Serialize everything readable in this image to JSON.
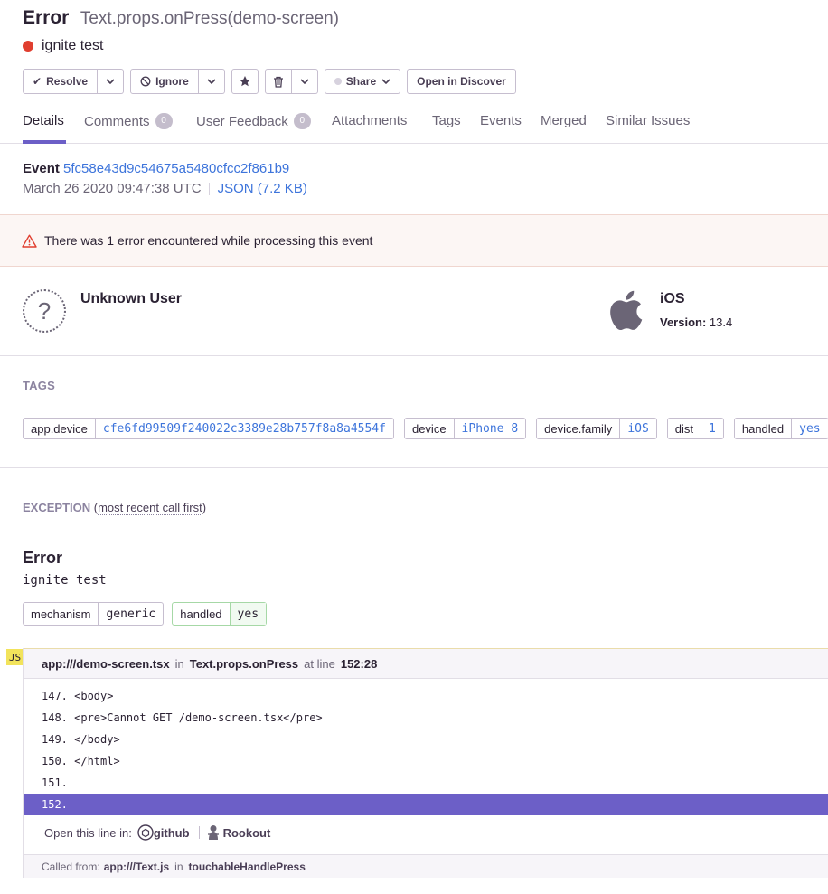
{
  "header": {
    "type": "Error",
    "culprit": "Text.props.onPress(demo-screen)",
    "message": "ignite test"
  },
  "actions": {
    "resolve": "Resolve",
    "ignore": "Ignore",
    "share": "Share",
    "open_discover": "Open in Discover"
  },
  "tabs": [
    {
      "label": "Details"
    },
    {
      "label": "Comments",
      "badge": "0"
    },
    {
      "label": "User Feedback",
      "badge": "0"
    },
    {
      "label": "Attachments"
    },
    {
      "label": "Tags"
    },
    {
      "label": "Events"
    },
    {
      "label": "Merged"
    },
    {
      "label": "Similar Issues"
    }
  ],
  "event": {
    "label": "Event",
    "id": "5fc58e43d9c54675a5480cfcc2f861b9",
    "date": "March 26 2020 09:47:38 UTC",
    "json": "JSON (7.2 KB)"
  },
  "banner": {
    "text": "There was 1 error encountered while processing this event"
  },
  "user": {
    "name": "Unknown User",
    "avatar_glyph": "?"
  },
  "os": {
    "name": "iOS",
    "version_label": "Version:",
    "version": "13.4"
  },
  "tags_section": {
    "title": "TAGS",
    "items": [
      {
        "key": "app.device",
        "value": "cfe6fd99509f240022c3389e28b757f8a8a4554f"
      },
      {
        "key": "device",
        "value": "iPhone 8"
      },
      {
        "key": "device.family",
        "value": "iOS"
      },
      {
        "key": "dist",
        "value": "1"
      },
      {
        "key": "handled",
        "value": "yes"
      }
    ]
  },
  "exception": {
    "title": "EXCEPTION",
    "order_prefix": "(",
    "order_text": "most recent call first",
    "order_suffix": ")",
    "type": "Error",
    "value": "ignite test",
    "mechanism": [
      {
        "key": "mechanism",
        "value": "generic"
      },
      {
        "key": "handled",
        "value": "yes"
      }
    ]
  },
  "frame": {
    "platform": "JS",
    "file": "app:///demo-screen.tsx",
    "in": "in",
    "function": "Text.props.onPress",
    "at_line": "at line",
    "line": "152:28",
    "code": [
      "147. <body>",
      "148. <pre>Cannot GET /demo-screen.tsx</pre>",
      "149. </body>",
      "150. </html>",
      "151. ",
      "152. "
    ],
    "open_line_label": "Open this line in:",
    "github": "github",
    "rookout": "Rookout",
    "called_from_label": "Called from:",
    "called_from_file": "app:///Text.js",
    "called_from_in": "in",
    "called_from_function": "touchableHandlePress"
  }
}
